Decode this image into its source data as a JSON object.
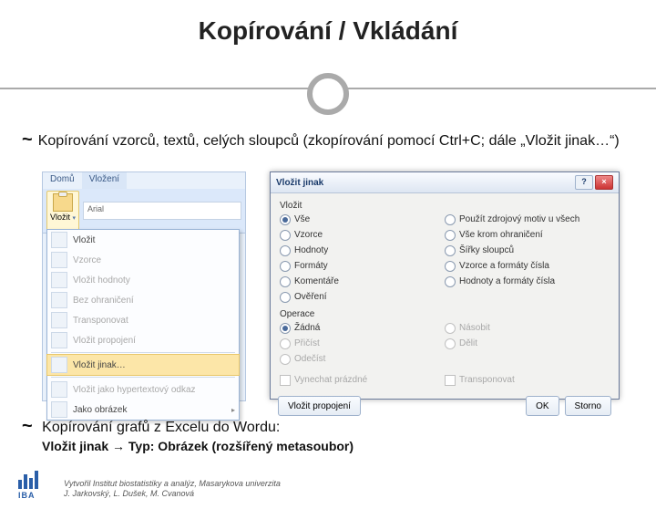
{
  "title": "Kopírování / Vkládání",
  "bullets": {
    "b1": "Kopírování vzorců, textů, celých sloupců (zkopírování pomocí Ctrl+C; dále „Vložit jinak…“)",
    "b2": "Kopírování grafů z Excelu do Wordu:",
    "b2_sub": "Vložit jinak → Typ: Obrázek (rozšířený metasoubor)"
  },
  "footer": {
    "l1": "Vytvořil Institut biostatistiky a analýz, Masarykova univerzita",
    "l2": "J. Jarkovský, L. Dušek, M. Cvanová"
  },
  "iba_label": "IBA",
  "excel": {
    "tabs": {
      "home": "Domů",
      "insert": "Vložení"
    },
    "paste_button": "Vložit",
    "font_family": "Arial",
    "menu": {
      "vlozit": "Vložit",
      "vzorce": "Vzorce",
      "hodnoty": "Vložit hodnoty",
      "bez_ohraniceni": "Bez ohraničení",
      "transponovat": "Transponovat",
      "propojeni": "Vložit propojení",
      "jinak": "Vložit jinak…",
      "hyperlink": "Vložit jako hypertextový odkaz",
      "obrazek": "Jako obrázek"
    }
  },
  "dialog": {
    "title": "Vložit jinak",
    "help_btn": "?",
    "close_btn": "×",
    "group_vlozit": "Vložit",
    "left_col": {
      "vse": "Vše",
      "vzorce": "Vzorce",
      "hodnoty": "Hodnoty",
      "formaty": "Formáty",
      "komentare": "Komentáře",
      "overeni": "Ověření"
    },
    "right_col": {
      "motiv": "Použít zdrojový motiv u všech",
      "vse_krome": "Vše krom ohraničení",
      "sirky": "Šířky sloupců",
      "vzorce_a_form": "Vzorce a formáty čísla",
      "hodn_a_form": "Hodnoty a formáty čísla"
    },
    "group_operace": "Operace",
    "op_left": {
      "zadna": "Žádná",
      "pricist": "Přičíst",
      "odecist": "Odečíst"
    },
    "op_right": {
      "nasobit": "Násobit",
      "delit": "Dělit"
    },
    "vynechat": "Vynechat prázdné",
    "transponovat": "Transponovat",
    "btn_propojeni": "Vložit propojení",
    "btn_ok": "OK",
    "btn_storno": "Storno"
  }
}
